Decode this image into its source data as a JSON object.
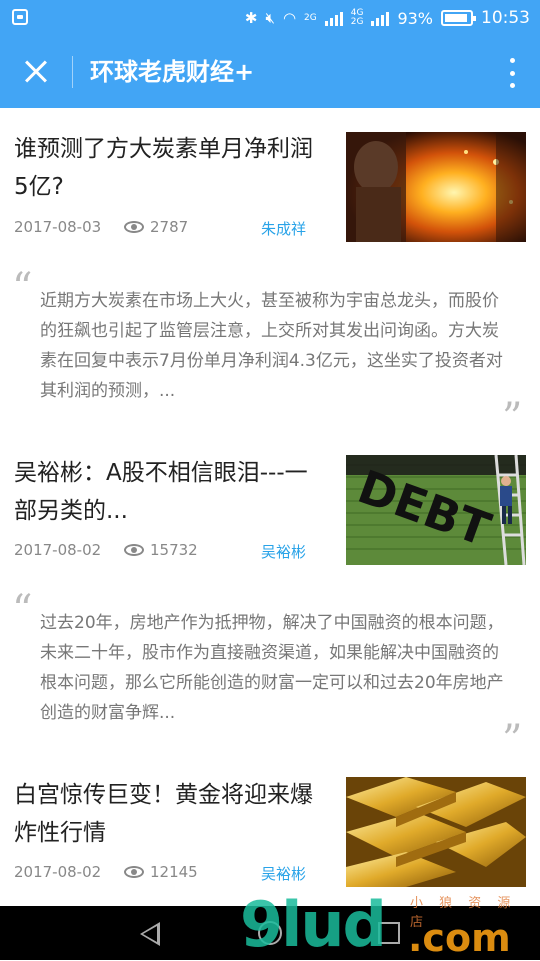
{
  "status_bar": {
    "network_label_1": "2G",
    "network_label_2": "4G",
    "network_label_3": "2G",
    "battery_percent": "93%",
    "time": "10:53",
    "icons": [
      "bluetooth-icon",
      "mute-icon",
      "wifi-icon",
      "signal-icon",
      "battery-icon"
    ]
  },
  "app_bar": {
    "title": "环球老虎财经+",
    "close_icon": "close-icon",
    "more_icon": "more-vertical-icon",
    "background": "#42a5f5"
  },
  "articles": [
    {
      "title": "谁预测了方大炭素单月净利润5亿?",
      "date": "2017-08-03",
      "views": "2787",
      "author": "朱成祥",
      "thumbnail": "molten-steel-furnace-image",
      "excerpt": "近期方大炭素在市场上大火，甚至被称为宇宙总龙头，而股价的狂飙也引起了监管层注意，上交所对其发出问询函。方大炭素在回复中表示7月份单月净利润4.3亿元，这坐实了投资者对其利润的预测，..."
    },
    {
      "title": "吴裕彬：A股不相信眼泪---一部另类的...",
      "date": "2017-08-02",
      "views": "15732",
      "author": "吴裕彬",
      "thumbnail": "debt-ladder-image",
      "thumbnail_text": "DEBT",
      "excerpt": "过去20年，房地产作为抵押物，解决了中国融资的根本问题，未来二十年，股市作为直接融资渠道，如果能解决中国融资的根本问题，那么它所能创造的财富一定可以和过去20年房地产创造的财富争辉..."
    },
    {
      "title": "白宫惊传巨变！黄金将迎来爆炸性行情",
      "date": "2017-08-02",
      "views": "12145",
      "author": "吴裕彬",
      "thumbnail": "gold-bars-image"
    }
  ],
  "quote_open": "“",
  "quote_close": "”",
  "watermark": {
    "logo": "9lud",
    "suffix": ".com",
    "small_text": "小 狼 资 源 店"
  },
  "colors": {
    "accent": "#42a5f5",
    "author_link": "#29a3e8"
  }
}
